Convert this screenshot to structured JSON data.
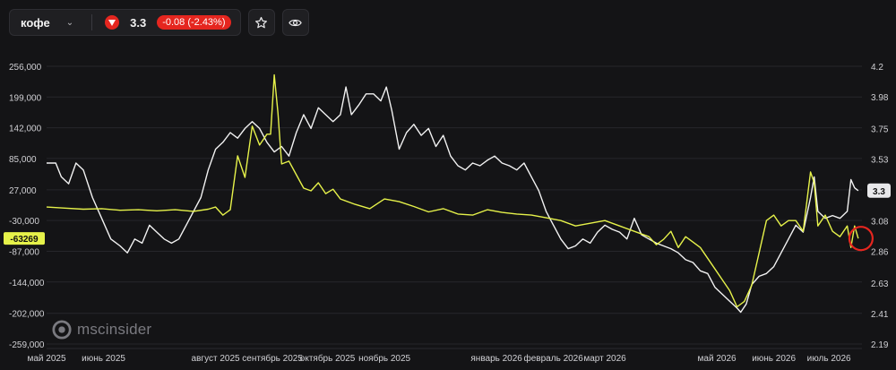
{
  "toolbar": {
    "ticker": "кофе",
    "price": "3.3",
    "change": "-0.08 (-2.43%)"
  },
  "brand": "mscinsider",
  "colors": {
    "white_series": "#f2f2f2",
    "yellow_series": "#e6f24a",
    "down": "#e5261f",
    "background": "#141416"
  },
  "chart_data": {
    "type": "line",
    "x_labels": [
      "май 2025",
      "июнь 2025",
      "август 2025",
      "сентябрь 2025",
      "октябрь 2025",
      "ноябрь 2025",
      "январь 2026",
      "февраль 2026",
      "март 2026",
      "май 2026",
      "июнь 2026",
      "июль 2026"
    ],
    "x_tick_days": [
      0,
      31,
      92,
      123,
      153,
      184,
      245,
      276,
      304,
      365,
      396,
      426
    ],
    "left_axis": {
      "ticks": [
        "256,000",
        "199,000",
        "142,000",
        "85,000",
        "27,000",
        "-30,000",
        "-87,000",
        "-144,000",
        "-202,000",
        "-259,000"
      ],
      "range": [
        -259000,
        256000
      ]
    },
    "right_axis": {
      "ticks": [
        "4.2",
        "3.98",
        "3.75",
        "3.53",
        "3.3",
        "3.08",
        "2.86",
        "2.63",
        "2.41",
        "2.19"
      ],
      "range": [
        2.19,
        4.2
      ]
    },
    "last_left_label": "-63269",
    "last_right_label": "3.3",
    "series": [
      {
        "axis": "right",
        "color": "#f2f2f2",
        "points": [
          [
            0,
            3.5
          ],
          [
            5,
            3.5
          ],
          [
            8,
            3.4
          ],
          [
            12,
            3.35
          ],
          [
            16,
            3.5
          ],
          [
            20,
            3.45
          ],
          [
            25,
            3.25
          ],
          [
            30,
            3.1
          ],
          [
            35,
            2.95
          ],
          [
            40,
            2.9
          ],
          [
            44,
            2.85
          ],
          [
            48,
            2.95
          ],
          [
            52,
            2.92
          ],
          [
            56,
            3.05
          ],
          [
            60,
            3.0
          ],
          [
            64,
            2.95
          ],
          [
            68,
            2.92
          ],
          [
            72,
            2.95
          ],
          [
            76,
            3.05
          ],
          [
            80,
            3.15
          ],
          [
            84,
            3.25
          ],
          [
            88,
            3.45
          ],
          [
            92,
            3.6
          ],
          [
            96,
            3.65
          ],
          [
            100,
            3.72
          ],
          [
            104,
            3.68
          ],
          [
            108,
            3.75
          ],
          [
            112,
            3.8
          ],
          [
            116,
            3.75
          ],
          [
            120,
            3.65
          ],
          [
            124,
            3.58
          ],
          [
            128,
            3.62
          ],
          [
            132,
            3.55
          ],
          [
            136,
            3.72
          ],
          [
            140,
            3.85
          ],
          [
            144,
            3.75
          ],
          [
            148,
            3.9
          ],
          [
            152,
            3.85
          ],
          [
            156,
            3.8
          ],
          [
            160,
            3.85
          ],
          [
            163,
            4.05
          ],
          [
            166,
            3.85
          ],
          [
            170,
            3.92
          ],
          [
            174,
            4.0
          ],
          [
            178,
            4.0
          ],
          [
            182,
            3.95
          ],
          [
            185,
            4.05
          ],
          [
            188,
            3.88
          ],
          [
            192,
            3.6
          ],
          [
            196,
            3.72
          ],
          [
            200,
            3.78
          ],
          [
            204,
            3.7
          ],
          [
            208,
            3.75
          ],
          [
            212,
            3.62
          ],
          [
            216,
            3.7
          ],
          [
            220,
            3.55
          ],
          [
            224,
            3.48
          ],
          [
            228,
            3.45
          ],
          [
            232,
            3.5
          ],
          [
            236,
            3.48
          ],
          [
            240,
            3.52
          ],
          [
            244,
            3.55
          ],
          [
            248,
            3.5
          ],
          [
            252,
            3.48
          ],
          [
            256,
            3.45
          ],
          [
            260,
            3.5
          ],
          [
            264,
            3.4
          ],
          [
            268,
            3.3
          ],
          [
            272,
            3.15
          ],
          [
            276,
            3.05
          ],
          [
            280,
            2.95
          ],
          [
            284,
            2.88
          ],
          [
            288,
            2.9
          ],
          [
            292,
            2.95
          ],
          [
            296,
            2.92
          ],
          [
            300,
            3.0
          ],
          [
            304,
            3.05
          ],
          [
            308,
            3.02
          ],
          [
            312,
            3.0
          ],
          [
            316,
            2.95
          ],
          [
            320,
            3.1
          ],
          [
            324,
            2.98
          ],
          [
            328,
            2.95
          ],
          [
            332,
            2.92
          ],
          [
            336,
            2.9
          ],
          [
            340,
            2.88
          ],
          [
            344,
            2.85
          ],
          [
            348,
            2.8
          ],
          [
            352,
            2.78
          ],
          [
            356,
            2.72
          ],
          [
            360,
            2.7
          ],
          [
            364,
            2.6
          ],
          [
            368,
            2.55
          ],
          [
            372,
            2.5
          ],
          [
            376,
            2.45
          ],
          [
            378,
            2.42
          ],
          [
            381,
            2.48
          ],
          [
            384,
            2.62
          ],
          [
            388,
            2.68
          ],
          [
            392,
            2.7
          ],
          [
            396,
            2.75
          ],
          [
            400,
            2.85
          ],
          [
            404,
            2.95
          ],
          [
            408,
            3.05
          ],
          [
            412,
            3.0
          ],
          [
            416,
            3.25
          ],
          [
            418,
            3.4
          ],
          [
            420,
            3.15
          ],
          [
            424,
            3.1
          ],
          [
            428,
            3.12
          ],
          [
            432,
            3.1
          ],
          [
            436,
            3.15
          ],
          [
            438,
            3.38
          ],
          [
            440,
            3.32
          ],
          [
            442,
            3.3
          ]
        ]
      },
      {
        "axis": "left",
        "color": "#e6f24a",
        "points": [
          [
            0,
            -5000
          ],
          [
            10,
            -7000
          ],
          [
            20,
            -9000
          ],
          [
            30,
            -8000
          ],
          [
            40,
            -11000
          ],
          [
            50,
            -10000
          ],
          [
            60,
            -12000
          ],
          [
            70,
            -10000
          ],
          [
            80,
            -13000
          ],
          [
            88,
            -9000
          ],
          [
            92,
            -5000
          ],
          [
            96,
            -20000
          ],
          [
            100,
            -10000
          ],
          [
            104,
            90000
          ],
          [
            108,
            50000
          ],
          [
            112,
            145000
          ],
          [
            116,
            110000
          ],
          [
            120,
            130000
          ],
          [
            122,
            130000
          ],
          [
            124,
            240000
          ],
          [
            126,
            170000
          ],
          [
            128,
            75000
          ],
          [
            132,
            80000
          ],
          [
            136,
            55000
          ],
          [
            140,
            30000
          ],
          [
            144,
            25000
          ],
          [
            148,
            40000
          ],
          [
            152,
            20000
          ],
          [
            156,
            28000
          ],
          [
            160,
            10000
          ],
          [
            168,
            0
          ],
          [
            176,
            -8000
          ],
          [
            184,
            10000
          ],
          [
            192,
            5000
          ],
          [
            200,
            -4000
          ],
          [
            208,
            -14000
          ],
          [
            216,
            -8000
          ],
          [
            224,
            -18000
          ],
          [
            232,
            -20000
          ],
          [
            240,
            -10000
          ],
          [
            248,
            -15000
          ],
          [
            256,
            -18000
          ],
          [
            264,
            -20000
          ],
          [
            272,
            -25000
          ],
          [
            280,
            -30000
          ],
          [
            288,
            -40000
          ],
          [
            296,
            -35000
          ],
          [
            304,
            -30000
          ],
          [
            312,
            -40000
          ],
          [
            320,
            -50000
          ],
          [
            328,
            -60000
          ],
          [
            332,
            -75000
          ],
          [
            336,
            -65000
          ],
          [
            340,
            -50000
          ],
          [
            344,
            -80000
          ],
          [
            348,
            -60000
          ],
          [
            352,
            -70000
          ],
          [
            356,
            -80000
          ],
          [
            360,
            -100000
          ],
          [
            364,
            -120000
          ],
          [
            368,
            -140000
          ],
          [
            372,
            -160000
          ],
          [
            376,
            -190000
          ],
          [
            380,
            -180000
          ],
          [
            384,
            -150000
          ],
          [
            388,
            -90000
          ],
          [
            392,
            -30000
          ],
          [
            396,
            -20000
          ],
          [
            400,
            -40000
          ],
          [
            404,
            -30000
          ],
          [
            408,
            -30000
          ],
          [
            412,
            -50000
          ],
          [
            416,
            60000
          ],
          [
            418,
            40000
          ],
          [
            420,
            -40000
          ],
          [
            424,
            -20000
          ],
          [
            428,
            -50000
          ],
          [
            432,
            -60000
          ],
          [
            436,
            -40000
          ],
          [
            438,
            -80000
          ],
          [
            440,
            -40000
          ],
          [
            442,
            -63269
          ]
        ]
      }
    ]
  }
}
